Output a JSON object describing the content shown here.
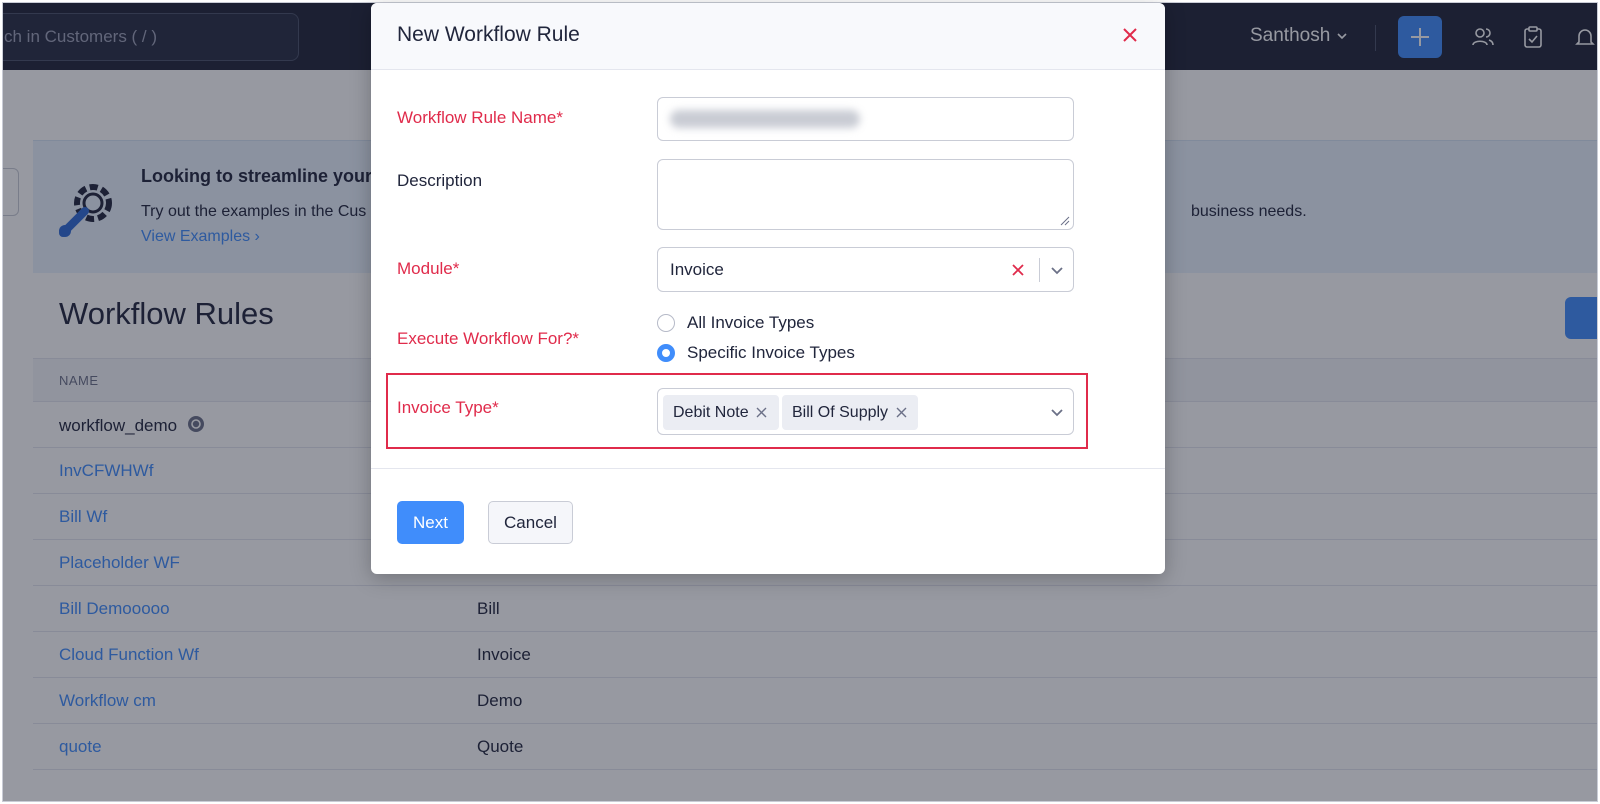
{
  "topbar": {
    "search_placeholder": "ch in Customers ( / )",
    "user_name": "Santhosh"
  },
  "banner": {
    "title": "Looking to streamline your",
    "text_left": "Try out the examples in the Cus",
    "text_right": "business needs.",
    "link": "View Examples ›"
  },
  "page": {
    "title": "Workflow Rules",
    "column_name": "NAME"
  },
  "rows": [
    {
      "name": "workflow_demo",
      "module": ""
    },
    {
      "name": "InvCFWHWf",
      "module": ""
    },
    {
      "name": "Bill Wf",
      "module": ""
    },
    {
      "name": "Placeholder WF",
      "module": ""
    },
    {
      "name": "Bill Demooooo",
      "module": "Bill"
    },
    {
      "name": "Cloud Function Wf",
      "module": "Invoice"
    },
    {
      "name": "Workflow cm",
      "module": "Demo"
    },
    {
      "name": "quote",
      "module": "Quote"
    }
  ],
  "modal": {
    "title": "New Workflow Rule",
    "labels": {
      "rule_name": "Workflow Rule Name*",
      "description": "Description",
      "module": "Module*",
      "execute_for": "Execute Workflow For?*",
      "invoice_type": "Invoice Type*"
    },
    "module_value": "Invoice",
    "radio_options": [
      "All Invoice Types",
      "Specific Invoice Types"
    ],
    "selected_radio": "Specific Invoice Types",
    "invoice_types": [
      "Debit Note",
      "Bill Of Supply"
    ],
    "buttons": {
      "next": "Next",
      "cancel": "Cancel"
    }
  },
  "colors": {
    "accent": "#408dfb",
    "required": "#e02b4b",
    "topbar": "#1f2438"
  }
}
